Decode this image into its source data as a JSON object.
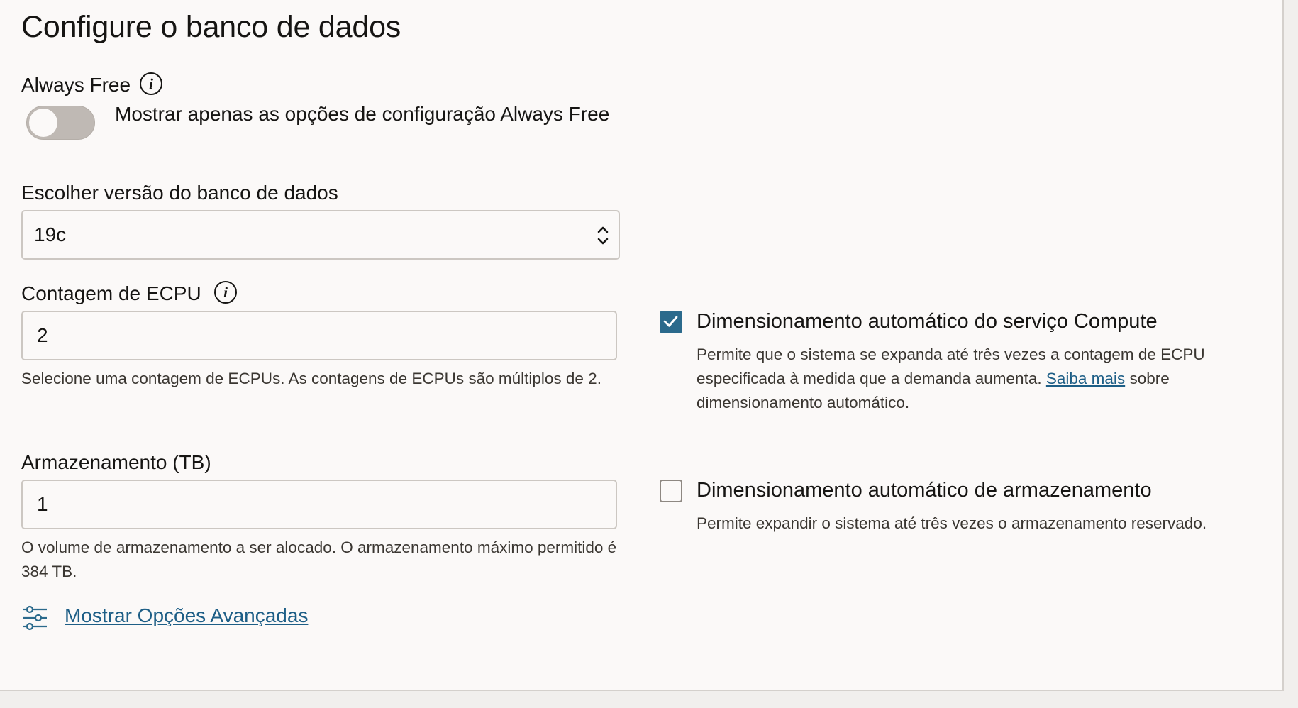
{
  "page": {
    "title": "Configure o banco de dados"
  },
  "always_free": {
    "label": "Always Free",
    "toggle_label": "Mostrar apenas as opções de configuração Always Free",
    "toggle_on": false
  },
  "db_version": {
    "label": "Escolher versão do banco de dados",
    "value": "19c"
  },
  "ecpu": {
    "label": "Contagem de ECPU",
    "value": "2",
    "help": "Selecione uma contagem de ECPUs. As contagens de ECPUs são múltiplos de 2."
  },
  "compute_autoscaling": {
    "label": "Dimensionamento automático do serviço Compute",
    "checked": true,
    "help_line1": "Permite que o sistema se expanda até três vezes a contagem de ECPU",
    "help_line2_pre": "especificada à medida que a demanda aumenta.",
    "help_link": "Saiba mais",
    "help_line2_post": "sobre",
    "help_line3": "dimensionamento automático."
  },
  "storage": {
    "label": "Armazenamento (TB)",
    "value": "1",
    "help_line1": "O volume de armazenamento a ser alocado. O armazenamento máximo permitido é",
    "help_line2": "384 TB."
  },
  "storage_autoscaling": {
    "label": "Dimensionamento automático de armazenamento",
    "checked": false,
    "help": "Permite expandir o sistema até três vezes o armazenamento reservado."
  },
  "advanced": {
    "link_label": "Mostrar Opções Avançadas"
  },
  "colors": {
    "accent": "#2b6a8c",
    "link": "#1d5e86",
    "background": "#fbf9f8"
  }
}
